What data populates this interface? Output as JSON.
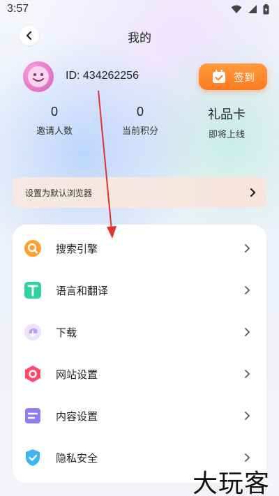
{
  "status_bar": {
    "time": "3:57"
  },
  "header": {
    "title": "我的"
  },
  "profile": {
    "user_id": "ID: 434262256"
  },
  "checkin": {
    "label": "签到"
  },
  "stats": [
    {
      "value": "0",
      "label": "邀请人数"
    },
    {
      "value": "0",
      "label": "当前积分"
    },
    {
      "value": "礼品卡",
      "label": "即将上线"
    }
  ],
  "default_browser": {
    "label": "设置为默认浏览器"
  },
  "menu": {
    "items": [
      {
        "label": "搜索引擎",
        "icon": "search-engine-icon",
        "color": "#ff9f2e"
      },
      {
        "label": "语言和翻译",
        "icon": "translate-icon",
        "color": "#2fd39a"
      },
      {
        "label": "下载",
        "icon": "download-icon",
        "color": "#b59cf5"
      },
      {
        "label": "网站设置",
        "icon": "website-settings-icon",
        "color": "#ff4a6b"
      },
      {
        "label": "内容设置",
        "icon": "content-settings-icon",
        "color": "#8f7cf4"
      },
      {
        "label": "隐私安全",
        "icon": "privacy-shield-icon",
        "color": "#3fb4f5"
      }
    ]
  },
  "watermark": {
    "text": "大玩客"
  },
  "colors": {
    "accent_orange": "#ff8a2a",
    "annotation_red": "#e0332d"
  }
}
